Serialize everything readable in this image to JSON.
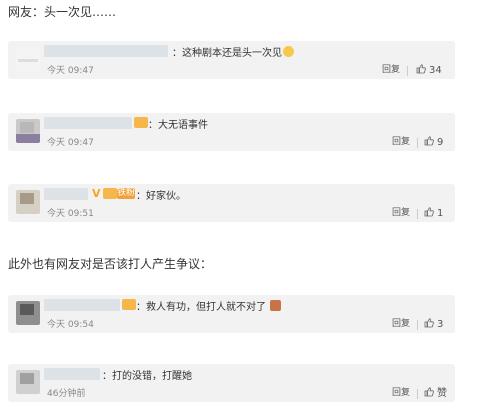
{
  "heading1": "网友：头一次见……",
  "heading2": "此外也有网友对是否该打人产生争议：",
  "comments": [
    {
      "text": "：这种剧本还是头一次见",
      "time": "今天 09:47",
      "reply": "回复",
      "likes": "34"
    },
    {
      "text": "：大无语事件",
      "time": "今天 09:47",
      "reply": "回复",
      "likes": "9"
    },
    {
      "text": "：好家伙。",
      "time": "今天 09:51",
      "reply": "回复",
      "likes": "1"
    },
    {
      "text": "：救人有功，但打人就不对了",
      "time": "今天 09:54",
      "reply": "回复",
      "likes": "3"
    },
    {
      "text": "：打的没错，打醒她",
      "time": "46分钟前",
      "reply": "回复",
      "likes": "赞"
    }
  ],
  "badges": {
    "v": "V",
    "fans": "铁粉"
  },
  "colors": {
    "card_bg": "#f2f2f2",
    "vip": "#f6b74a"
  }
}
